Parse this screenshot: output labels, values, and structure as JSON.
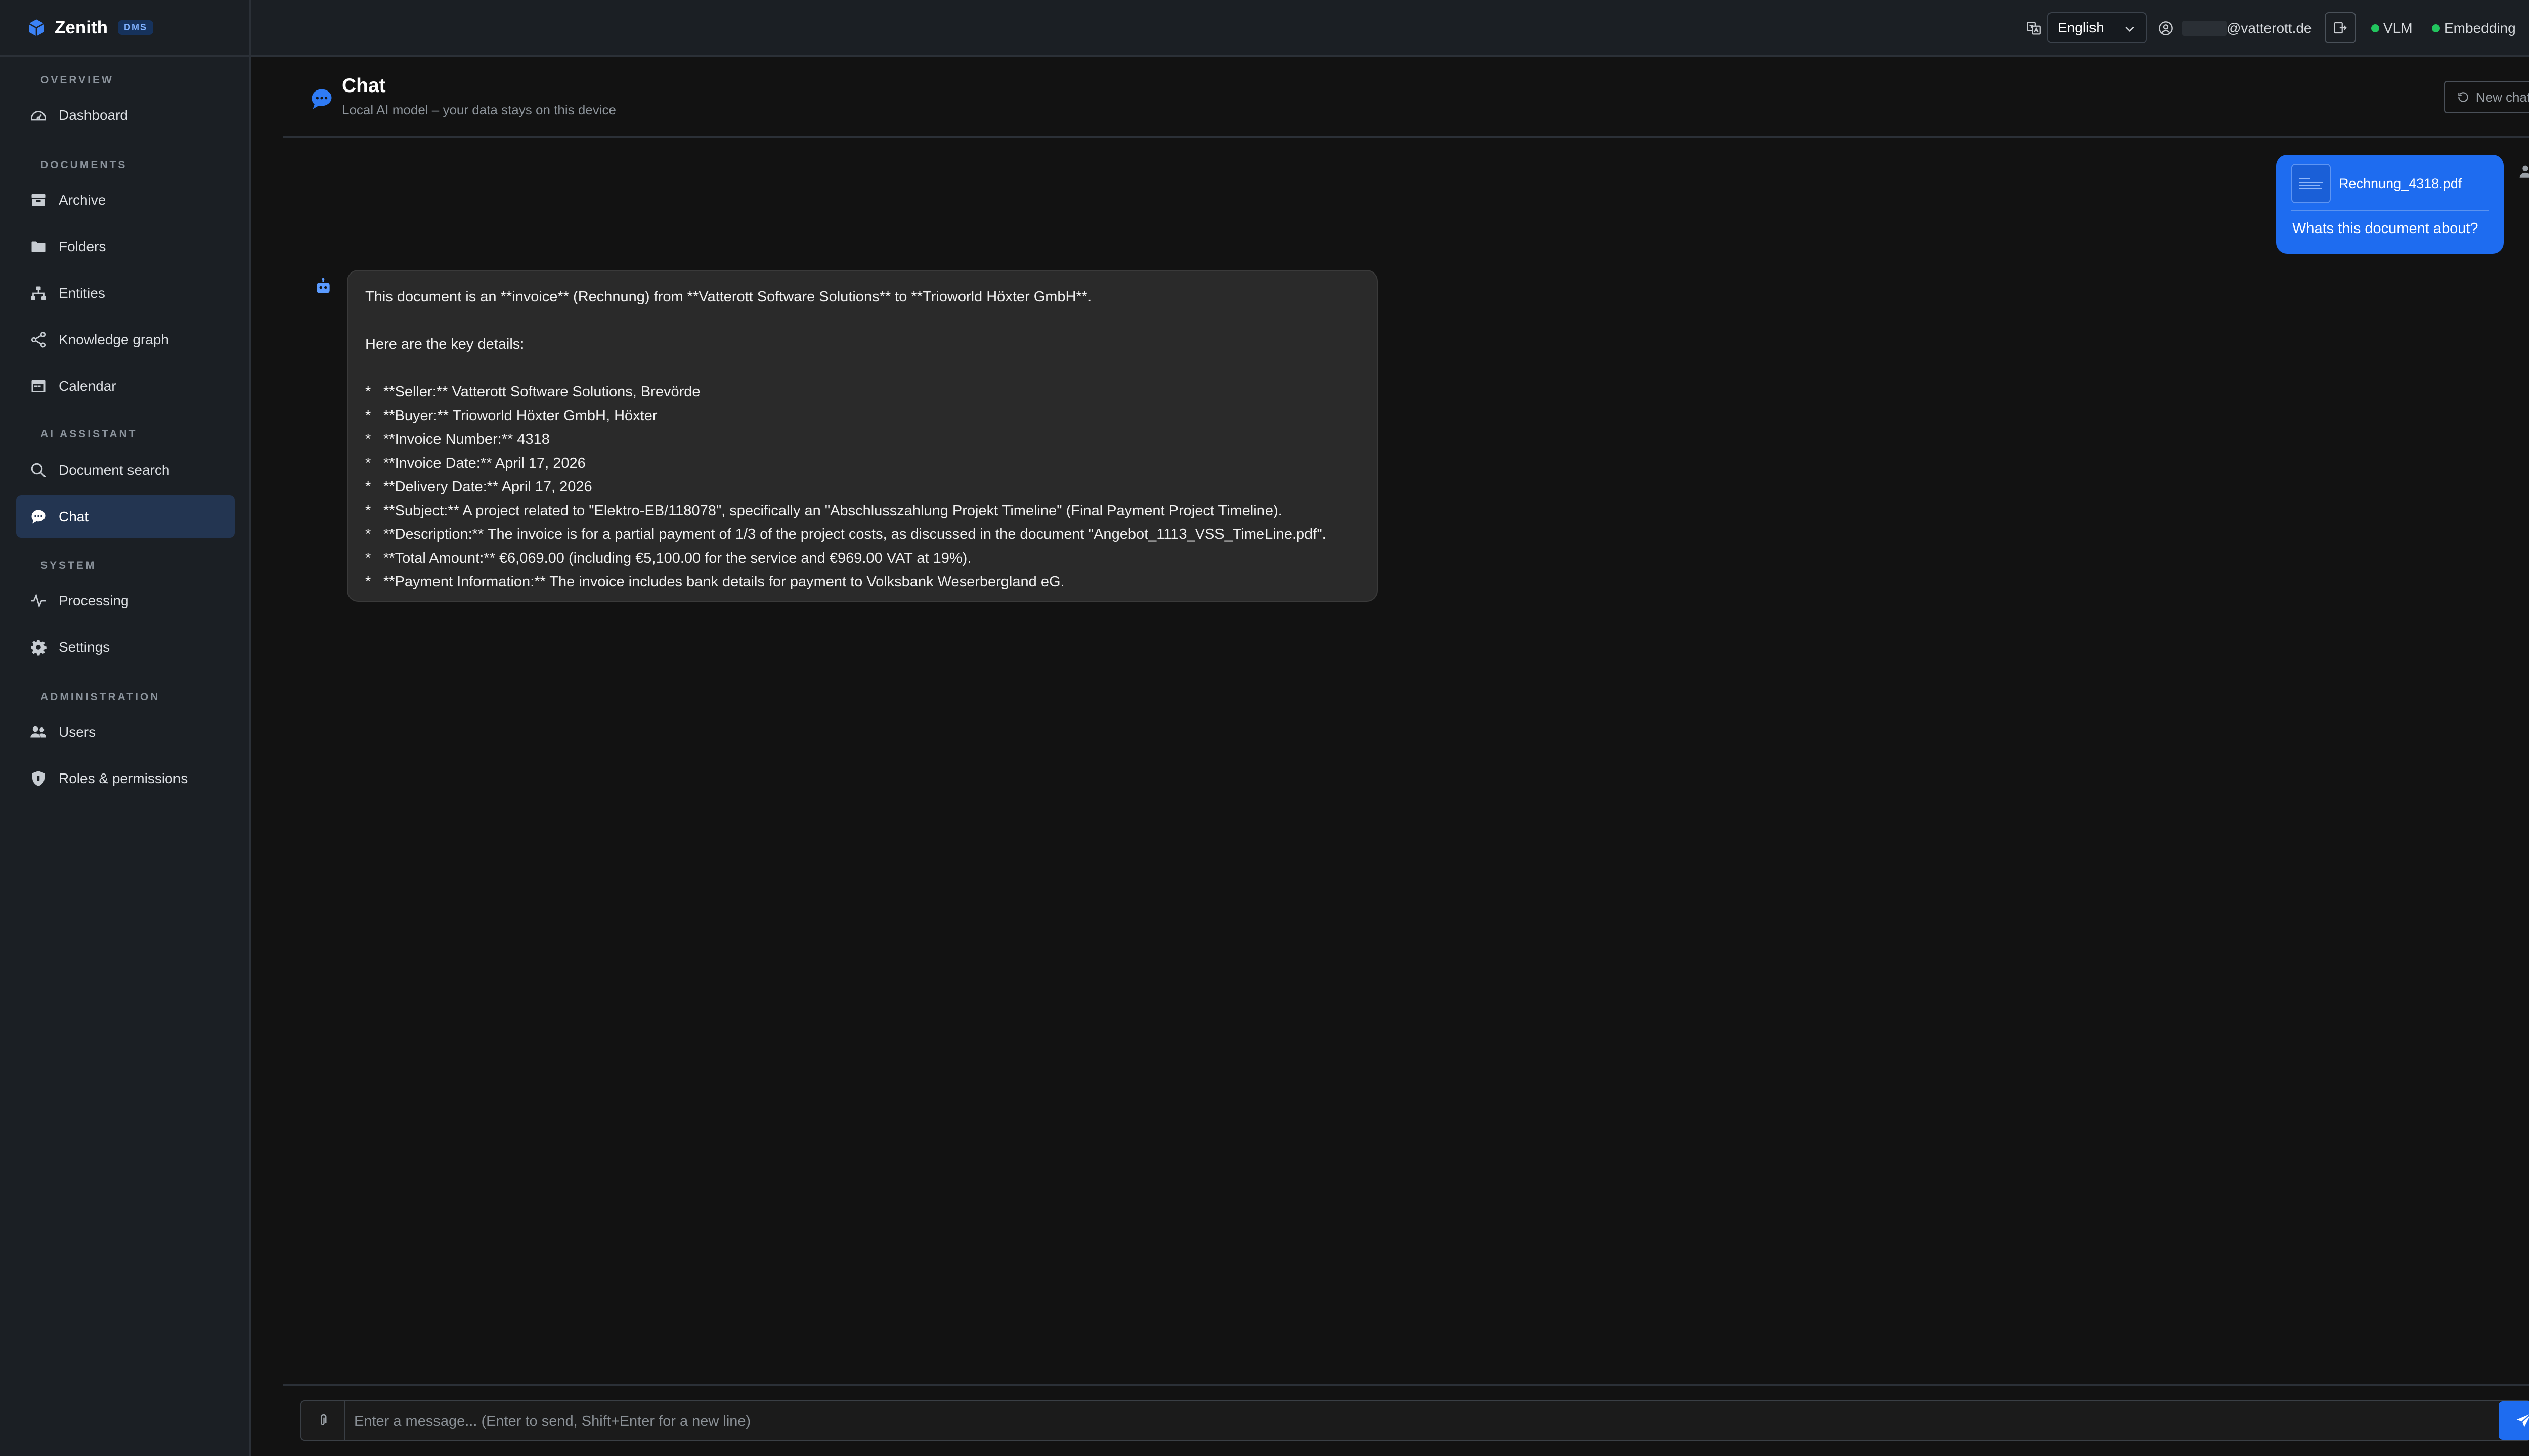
{
  "brand": {
    "name": "Zenith",
    "badge": "DMS"
  },
  "sidebar": {
    "sections": [
      {
        "label": "OVERVIEW",
        "items": [
          {
            "label": "Dashboard",
            "icon": "dashboard-icon"
          }
        ]
      },
      {
        "label": "DOCUMENTS",
        "items": [
          {
            "label": "Archive",
            "icon": "archive-icon"
          },
          {
            "label": "Folders",
            "icon": "folder-icon"
          },
          {
            "label": "Entities",
            "icon": "entities-icon"
          },
          {
            "label": "Knowledge graph",
            "icon": "share-icon"
          },
          {
            "label": "Calendar",
            "icon": "calendar-icon"
          }
        ]
      },
      {
        "label": "AI ASSISTANT",
        "items": [
          {
            "label": "Document search",
            "icon": "search-icon"
          },
          {
            "label": "Chat",
            "icon": "chat-icon",
            "active": true
          }
        ]
      },
      {
        "label": "SYSTEM",
        "items": [
          {
            "label": "Processing",
            "icon": "activity-icon"
          },
          {
            "label": "Settings",
            "icon": "gear-icon"
          }
        ]
      },
      {
        "label": "ADMINISTRATION",
        "items": [
          {
            "label": "Users",
            "icon": "users-icon"
          },
          {
            "label": "Roles & permissions",
            "icon": "shield-icon"
          }
        ]
      }
    ]
  },
  "topbar": {
    "language": "English",
    "user_email": "@vatterott.de",
    "status": [
      {
        "label": "VLM",
        "color": "#22c55e"
      },
      {
        "label": "Embedding",
        "color": "#22c55e"
      }
    ]
  },
  "chat": {
    "title": "Chat",
    "subtitle": "Local AI model – your data stays on this device",
    "new_chat_label": "New chat"
  },
  "messages": {
    "user": {
      "attachment": "Rechnung_4318.pdf",
      "text": "Whats this document about?"
    },
    "assistant": {
      "intro": "This document is an **invoice** (Rechnung) from **Vatterott Software Solutions** to **Trioworld Höxter GmbH**.",
      "lead": "Here are the key details:",
      "bullet": "*",
      "points": [
        "**Seller:** Vatterott Software Solutions, Brevörde",
        "**Buyer:** Trioworld Höxter GmbH, Höxter",
        "**Invoice Number:** 4318",
        "**Invoice Date:** April 17, 2026",
        "**Delivery Date:** April 17, 2026",
        "**Subject:** A project related to \"Elektro-EB/118078\", specifically an \"Abschlusszahlung Projekt Timeline\" (Final Payment Project Timeline).",
        "**Description:** The invoice is for a partial payment of 1/3 of the project costs, as discussed in the document \"Angebot_1113_VSS_TimeLine.pdf\".",
        "**Total Amount:** €6,069.00 (including €5,100.00 for the service and €969.00 VAT at 19%).",
        "**Payment Information:** The invoice includes bank details for payment to Volksbank Weserbergland eG."
      ]
    }
  },
  "composer": {
    "placeholder": "Enter a message... (Enter to send, Shift+Enter for a new line)"
  }
}
